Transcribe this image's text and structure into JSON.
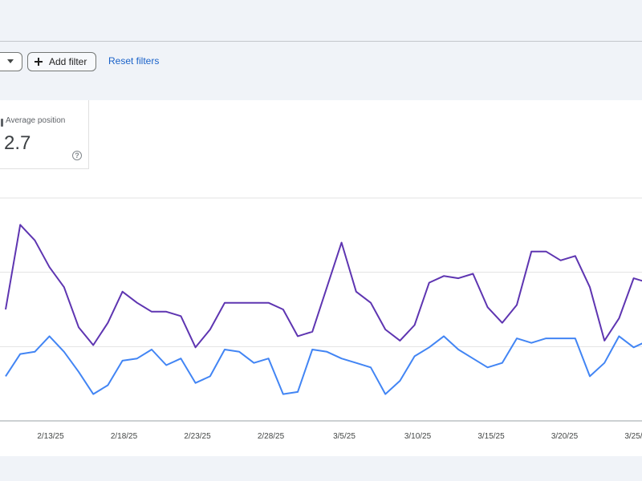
{
  "filters": {
    "add_filter_label": "Add filter",
    "reset_filters_label": "Reset filters"
  },
  "metric_card": {
    "label": "Average position",
    "value": "2.7",
    "help_glyph": "?"
  },
  "icons": {
    "add_filter": "plus-icon",
    "dropdown": "caret-down-icon",
    "help": "help-circle-icon"
  },
  "chart_data": {
    "type": "line",
    "x_tick_labels": [
      "2/13/25",
      "2/18/25",
      "2/23/25",
      "2/28/25",
      "3/5/25",
      "3/10/25",
      "3/15/25",
      "3/20/25",
      "3/25/25"
    ],
    "y_range": [
      0,
      1
    ],
    "grid": true,
    "colors": {
      "series_1": "#5e35b1",
      "series_2": "#4285f4"
    },
    "series": [
      {
        "values": [
          0.5,
          0.88,
          0.81,
          0.69,
          0.6,
          0.42,
          0.34,
          0.44,
          0.58,
          0.53,
          0.49,
          0.49,
          0.47,
          0.33,
          0.41,
          0.53,
          0.53,
          0.53,
          0.53,
          0.5,
          0.38,
          0.4,
          0.6,
          0.8,
          0.58,
          0.53,
          0.41,
          0.36,
          0.43,
          0.62,
          0.65,
          0.64,
          0.66,
          0.51,
          0.44,
          0.52,
          0.76,
          0.76,
          0.72,
          0.74,
          0.6,
          0.36,
          0.46,
          0.64,
          0.62,
          0.6
        ]
      },
      {
        "values": [
          0.2,
          0.3,
          0.31,
          0.38,
          0.31,
          0.22,
          0.12,
          0.16,
          0.27,
          0.28,
          0.32,
          0.25,
          0.28,
          0.17,
          0.2,
          0.32,
          0.31,
          0.26,
          0.28,
          0.12,
          0.13,
          0.32,
          0.31,
          0.28,
          0.26,
          0.24,
          0.12,
          0.18,
          0.29,
          0.33,
          0.38,
          0.32,
          0.28,
          0.24,
          0.26,
          0.37,
          0.35,
          0.37,
          0.37,
          0.37,
          0.2,
          0.26,
          0.38,
          0.33,
          0.36,
          0.32
        ]
      }
    ]
  }
}
